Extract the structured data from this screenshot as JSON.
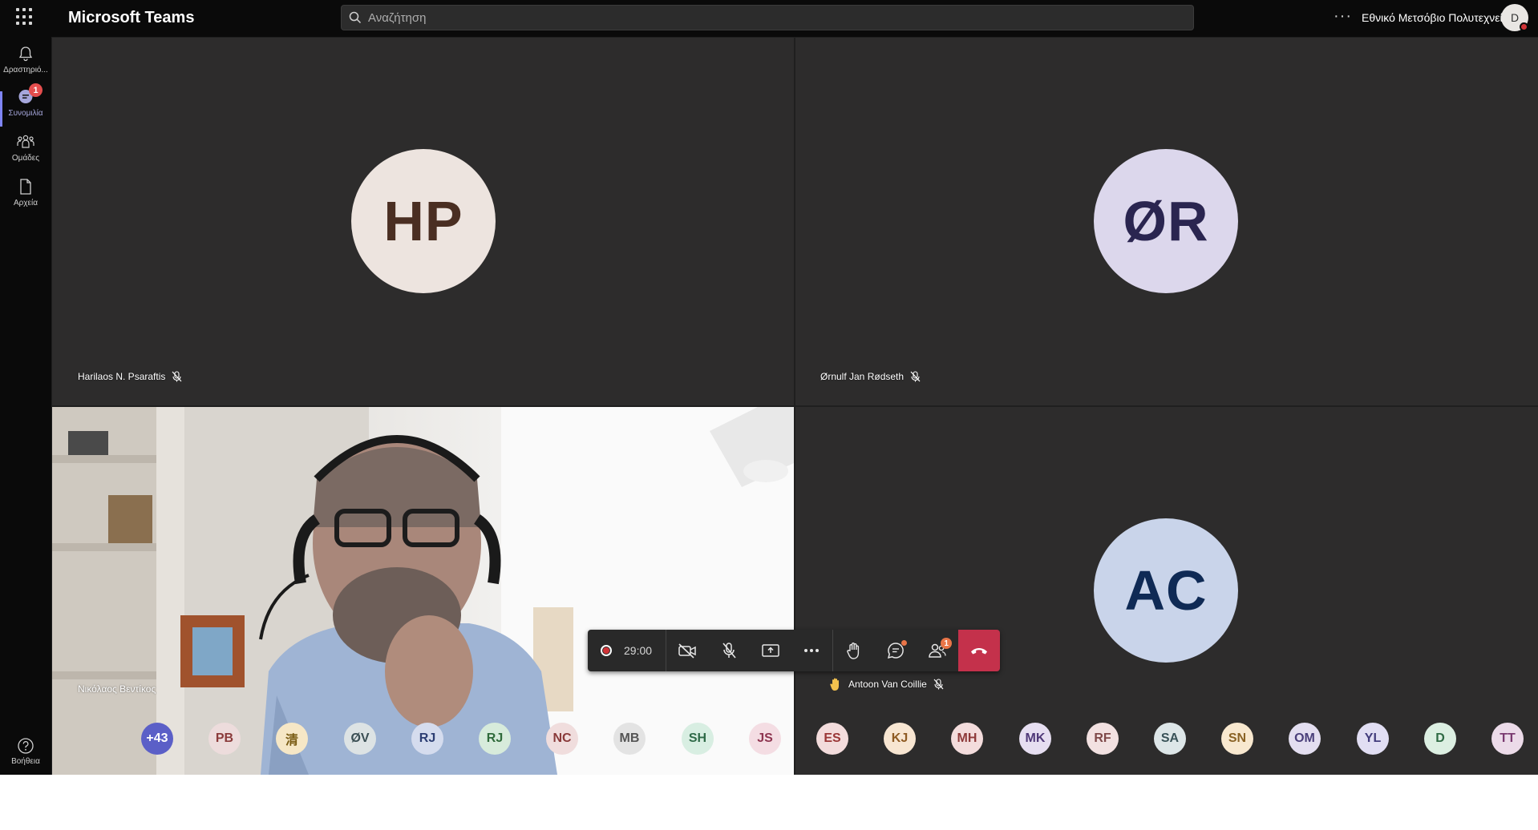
{
  "app": {
    "title": "Microsoft Teams"
  },
  "search": {
    "placeholder": "Αναζήτηση"
  },
  "header": {
    "more_label": "···",
    "org_name": "Εθνικό Μετσόβιο Πολυτεχνείο",
    "user_initial": "D"
  },
  "rail": {
    "items": [
      {
        "label": "Δραστηριό...",
        "icon": "bell-icon"
      },
      {
        "label": "Συνομιλία",
        "icon": "chat-icon",
        "badge": "1",
        "active": true
      },
      {
        "label": "Ομάδες",
        "icon": "teams-icon"
      },
      {
        "label": "Αρχεία",
        "icon": "file-icon"
      }
    ],
    "help_label": "Βοήθεια"
  },
  "tiles": [
    {
      "initials": "HP",
      "name": "Harilaos N. Psaraftis",
      "muted": true,
      "avatar_bg": "#ede4df",
      "avatar_fg": "#4a2e22"
    },
    {
      "initials": "ØR",
      "name": "Ørnulf Jan Rødseth",
      "muted": true,
      "avatar_bg": "#dcd7ec",
      "avatar_fg": "#2a2550"
    },
    {
      "name": "Νικόλαος Βεντίκος",
      "video": true
    },
    {
      "initials": "AC",
      "name": "Antoon Van Coillie",
      "muted": true,
      "hand_raised": true,
      "avatar_bg": "#c9d4ea",
      "avatar_fg": "#0f2a55"
    }
  ],
  "controls": {
    "timer": "29:00",
    "people_badge": "1",
    "buttons": [
      "camera-off-icon",
      "mic-off-icon",
      "share-screen-icon",
      "more-icon",
      "raise-hand-icon",
      "chat-icon",
      "participants-icon",
      "hang-up-icon"
    ]
  },
  "participants_row": [
    {
      "initials": "+43",
      "bg": "#5b5fc7",
      "fg": "#ffffff"
    },
    {
      "initials": "PB",
      "bg": "#eddcdc",
      "fg": "#8a3a3a"
    },
    {
      "initials": "清",
      "bg": "#f6e7c6",
      "fg": "#7a5c14"
    },
    {
      "initials": "ØV",
      "bg": "#dde3e4",
      "fg": "#3b4f54"
    },
    {
      "initials": "RJ",
      "bg": "#d5dcee",
      "fg": "#2d3e73"
    },
    {
      "initials": "RJ",
      "bg": "#d7ebdb",
      "fg": "#2f6a3a"
    },
    {
      "initials": "NC",
      "bg": "#f0dddd",
      "fg": "#8a3a3a"
    },
    {
      "initials": "MB",
      "bg": "#e3e3e3",
      "fg": "#555555"
    },
    {
      "initials": "SH",
      "bg": "#d8eee2",
      "fg": "#2f6a48"
    },
    {
      "initials": "JS",
      "bg": "#f4dde3",
      "fg": "#8e3550"
    },
    {
      "initials": "ES",
      "bg": "#f3dcdc",
      "fg": "#9a3636"
    },
    {
      "initials": "KJ",
      "bg": "#f8e6d2",
      "fg": "#8e5a22"
    },
    {
      "initials": "MH",
      "bg": "#f3dcdc",
      "fg": "#8e3a3a"
    },
    {
      "initials": "MK",
      "bg": "#e6def1",
      "fg": "#4f3878"
    },
    {
      "initials": "RF",
      "bg": "#f2e1e1",
      "fg": "#7e4848"
    },
    {
      "initials": "SA",
      "bg": "#dde6e8",
      "fg": "#395258"
    },
    {
      "initials": "SN",
      "bg": "#f8e8cf",
      "fg": "#8a6224"
    },
    {
      "initials": "OM",
      "bg": "#e3def0",
      "fg": "#4a3f7a"
    },
    {
      "initials": "YL",
      "bg": "#e1def3",
      "fg": "#423c7c"
    },
    {
      "initials": "D",
      "bg": "#dcefe2",
      "fg": "#2f6a44"
    },
    {
      "initials": "TT",
      "bg": "#ecdbe9",
      "fg": "#7a3a70"
    }
  ]
}
